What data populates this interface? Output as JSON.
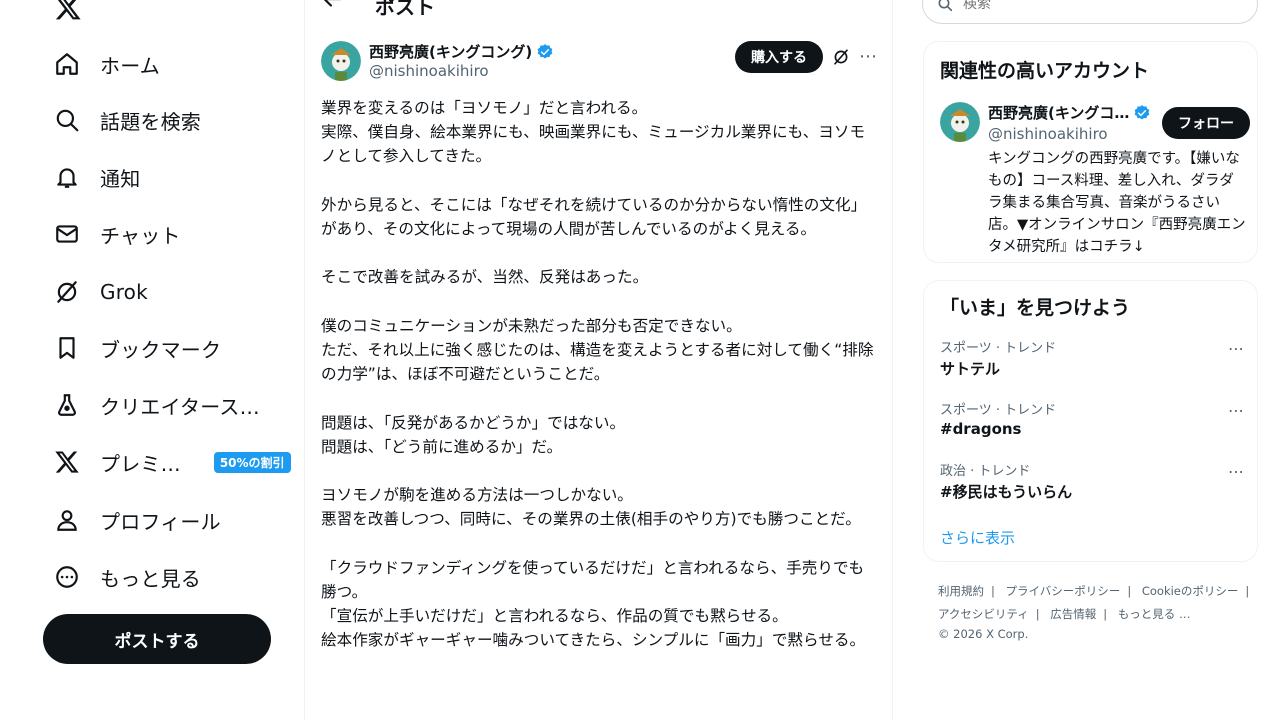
{
  "nav": {
    "items": [
      {
        "label": "ホーム",
        "icon": "home-icon"
      },
      {
        "label": "話題を検索",
        "icon": "search-icon"
      },
      {
        "label": "通知",
        "icon": "bell-icon"
      },
      {
        "label": "チャット",
        "icon": "mail-icon"
      },
      {
        "label": "Grok",
        "icon": "grok-icon"
      },
      {
        "label": "ブックマーク",
        "icon": "bookmark-icon"
      },
      {
        "label": "クリエイタース…",
        "icon": "creator-studio-icon"
      },
      {
        "label": "プレミ…",
        "icon": "x-premium-icon",
        "badge": "50%の割引"
      },
      {
        "label": "プロフィール",
        "icon": "profile-icon"
      },
      {
        "label": "もっと見る",
        "icon": "more-circle-icon"
      }
    ],
    "post_button": "ポストする"
  },
  "main": {
    "title": "ポスト",
    "author": {
      "name": "西野亮廣(キングコング)",
      "handle": "@nishinoakihiro"
    },
    "buy_button": "購入する",
    "tweet": {
      "paragraphs": [
        "業界を変えるのは「ヨソモノ」だと言われる。",
        "実際、僕自身、絵本業界にも、映画業界にも、ミュージカル業界にも、ヨソモノとして参入してきた。",
        "",
        "外から見ると、そこには「なぜそれを続けているのか分からない惰性の文化」があり、その文化によって現場の人間が苦しんでいるのがよく見える。",
        "",
        "そこで改善を試みるが、当然、反発はあった。",
        "",
        "僕のコミュニケーションが未熟だった部分も否定できない。",
        "ただ、それ以上に強く感じたのは、構造を変えようとする者に対して働く“排除の力学”は、ほぼ不可避だということだ。",
        "",
        "問題は、「反発があるかどうか」ではない。",
        "問題は、「どう前に進めるか」だ。",
        "",
        "ヨソモノが駒を進める方法は一つしかない。",
        "悪習を改善しつつ、同時に、その業界の土俵(相手のやり方)でも勝つことだ。",
        "",
        "「クラウドファンディングを使っているだけだ」と言われるなら、手売りでも勝つ。",
        "「宣伝が上手いだけだ」と言われるなら、作品の質でも黙らせる。",
        "絵本作家がギャーギャー噛みついてきたら、シンプルに「画力」で黙らせる。"
      ]
    }
  },
  "right": {
    "search_placeholder": "検索",
    "related": {
      "title": "関連性の高いアカウント",
      "name": "西野亮廣(キングコ…",
      "handle": "@nishinoakihiro",
      "follow_button": "フォロー",
      "bio": "キングコングの西野亮廣です。【嫌いなもの】コース料理、差し入れ、ダラダラ集まる集合写真、音楽がうるさい店。▼オンラインサロン『西野亮廣エンタメ研究所』はコチラ↓"
    },
    "trends": {
      "title": "「いま」を見つけよう",
      "items": [
        {
          "context": "スポーツ · トレンド",
          "name": "サトテル"
        },
        {
          "context": "スポーツ · トレンド",
          "name": "#dragons"
        },
        {
          "context": "政治 · トレンド",
          "name": "#移民はもういらん"
        }
      ],
      "show_more": "さらに表示"
    },
    "footer": {
      "links": [
        "利用規約",
        "プライバシーポリシー",
        "Cookieのポリシー",
        "アクセシビリティ",
        "広告情報",
        "もっと見る …"
      ],
      "copyright": "© 2026 X Corp."
    }
  },
  "colors": {
    "accent": "#1d9bf0",
    "text": "#0f1419",
    "secondary": "#536471",
    "border": "#eff3f4"
  }
}
